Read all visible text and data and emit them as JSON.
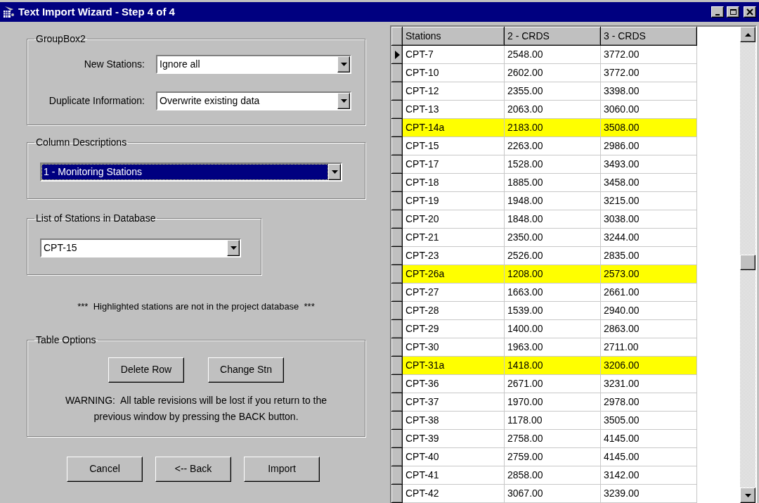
{
  "window": {
    "title": "Text Import Wizard - Step 4 of 4"
  },
  "group_box2": {
    "title": "GroupBox2",
    "fields": [
      {
        "label": "New Stations:",
        "value": "Ignore all"
      },
      {
        "label": "Duplicate Information:",
        "value": "Overwrite existing data"
      }
    ]
  },
  "column_descriptions": {
    "title": "Column Descriptions",
    "value": "1 - Monitoring Stations",
    "selected": true
  },
  "station_list": {
    "title": "List of Stations in Database",
    "value": "CPT-15",
    "selected": false
  },
  "note": "***  Highlighted stations are not in the project database  ***",
  "table_options": {
    "title": "Table Options",
    "buttons": [
      "Delete Row",
      "Change Stn"
    ],
    "warning_lines": [
      "WARNING:  All table revisions will be lost if you return to the",
      "previous window by pressing the BACK button."
    ]
  },
  "buttons": [
    "Cancel",
    "<-- Back",
    "Import"
  ],
  "grid": {
    "columns": [
      "Stations",
      "2 - CRDS",
      "3 - CRDS"
    ],
    "rows": [
      {
        "cells": [
          "CPT-7",
          "2548.00",
          "3772.00"
        ],
        "current": true,
        "highlighted": false
      },
      {
        "cells": [
          "CPT-10",
          "2602.00",
          "3772.00"
        ],
        "current": false,
        "highlighted": false
      },
      {
        "cells": [
          "CPT-12",
          "2355.00",
          "3398.00"
        ],
        "current": false,
        "highlighted": false
      },
      {
        "cells": [
          "CPT-13",
          "2063.00",
          "3060.00"
        ],
        "current": false,
        "highlighted": false
      },
      {
        "cells": [
          "CPT-14a",
          "2183.00",
          "3508.00"
        ],
        "current": false,
        "highlighted": true
      },
      {
        "cells": [
          "CPT-15",
          "2263.00",
          "2986.00"
        ],
        "current": false,
        "highlighted": false
      },
      {
        "cells": [
          "CPT-17",
          "1528.00",
          "3493.00"
        ],
        "current": false,
        "highlighted": false
      },
      {
        "cells": [
          "CPT-18",
          "1885.00",
          "3458.00"
        ],
        "current": false,
        "highlighted": false
      },
      {
        "cells": [
          "CPT-19",
          "1948.00",
          "3215.00"
        ],
        "current": false,
        "highlighted": false
      },
      {
        "cells": [
          "CPT-20",
          "1848.00",
          "3038.00"
        ],
        "current": false,
        "highlighted": false
      },
      {
        "cells": [
          "CPT-21",
          "2350.00",
          "3244.00"
        ],
        "current": false,
        "highlighted": false
      },
      {
        "cells": [
          "CPT-23",
          "2526.00",
          "2835.00"
        ],
        "current": false,
        "highlighted": false
      },
      {
        "cells": [
          "CPT-26a",
          "1208.00",
          "2573.00"
        ],
        "current": false,
        "highlighted": true
      },
      {
        "cells": [
          "CPT-27",
          "1663.00",
          "2661.00"
        ],
        "current": false,
        "highlighted": false
      },
      {
        "cells": [
          "CPT-28",
          "1539.00",
          "2940.00"
        ],
        "current": false,
        "highlighted": false
      },
      {
        "cells": [
          "CPT-29",
          "1400.00",
          "2863.00"
        ],
        "current": false,
        "highlighted": false
      },
      {
        "cells": [
          "CPT-30",
          "1963.00",
          "2711.00"
        ],
        "current": false,
        "highlighted": false
      },
      {
        "cells": [
          "CPT-31a",
          "1418.00",
          "3206.00"
        ],
        "current": false,
        "highlighted": true
      },
      {
        "cells": [
          "CPT-36",
          "2671.00",
          "3231.00"
        ],
        "current": false,
        "highlighted": false
      },
      {
        "cells": [
          "CPT-37",
          "1970.00",
          "2978.00"
        ],
        "current": false,
        "highlighted": false
      },
      {
        "cells": [
          "CPT-38",
          "1178.00",
          "3505.00"
        ],
        "current": false,
        "highlighted": false
      },
      {
        "cells": [
          "CPT-39",
          "2758.00",
          "4145.00"
        ],
        "current": false,
        "highlighted": false
      },
      {
        "cells": [
          "CPT-40",
          "2759.00",
          "4145.00"
        ],
        "current": false,
        "highlighted": false
      },
      {
        "cells": [
          "CPT-41",
          "2858.00",
          "3142.00"
        ],
        "current": false,
        "highlighted": false
      },
      {
        "cells": [
          "CPT-42",
          "3067.00",
          "3239.00"
        ],
        "current": false,
        "highlighted": false
      }
    ]
  }
}
